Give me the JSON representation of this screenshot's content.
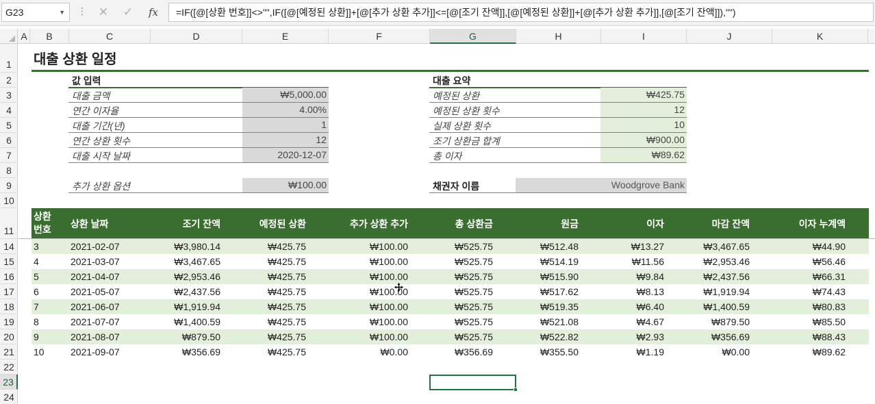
{
  "formula_bar": {
    "name_box": "G23",
    "cancel_glyph": "✕",
    "enter_glyph": "✓",
    "fx_label": "fx",
    "formula": "=IF([@[상환 번호]]<>\"\",IF([@[예정된 상환]]+[@[추가 상환 추가]]<=[@[조기 잔액]],[@[예정된 상환]]+[@[추가 상환 추가]],[@[조기 잔액]]),\"\")"
  },
  "columns": [
    "A",
    "B",
    "C",
    "D",
    "E",
    "F",
    "G",
    "H",
    "I",
    "J",
    "K"
  ],
  "selected_column": "G",
  "rows": [
    "1",
    "2",
    "3",
    "4",
    "5",
    "6",
    "7",
    "8",
    "9",
    "10",
    "11",
    "14",
    "15",
    "16",
    "17",
    "18",
    "19",
    "20",
    "21",
    "22",
    "23",
    "24"
  ],
  "selected_row": "23",
  "title": "대출 상환 일정",
  "inputs": {
    "heading": "값 입력",
    "items": [
      {
        "label": "대출 금액",
        "value": "₩5,000.00"
      },
      {
        "label": "연간 이자율",
        "value": "4.00%"
      },
      {
        "label": "대출 기간(년)",
        "value": "1"
      },
      {
        "label": "연간 상환 횟수",
        "value": "12"
      },
      {
        "label": "대출 시작 날짜",
        "value": "2020-12-07"
      }
    ],
    "extra": {
      "label": "추가 상환 옵션",
      "value": "₩100.00"
    }
  },
  "summary": {
    "heading": "대출 요약",
    "items": [
      {
        "label": "예정된 상환",
        "value": "₩425.75"
      },
      {
        "label": "예정된 상환 횟수",
        "value": "12"
      },
      {
        "label": "실제 상환 횟수",
        "value": "10"
      },
      {
        "label": "조기 상환금 합계",
        "value": "₩900.00"
      },
      {
        "label": "총 이자",
        "value": "₩89.62"
      }
    ],
    "lender": {
      "label": "채권자 이름",
      "value": "Woodgrove Bank"
    }
  },
  "table": {
    "headers": [
      "상환 번호",
      "상환 날짜",
      "조기 잔액",
      "예정된 상환",
      "추가 상환 추가",
      "총 상환금",
      "원금",
      "이자",
      "마감 잔액",
      "이자 누계액"
    ],
    "rows": [
      [
        "3",
        "2021-02-07",
        "₩3,980.14",
        "₩425.75",
        "₩100.00",
        "₩525.75",
        "₩512.48",
        "₩13.27",
        "₩3,467.65",
        "₩44.90"
      ],
      [
        "4",
        "2021-03-07",
        "₩3,467.65",
        "₩425.75",
        "₩100.00",
        "₩525.75",
        "₩514.19",
        "₩11.56",
        "₩2,953.46",
        "₩56.46"
      ],
      [
        "5",
        "2021-04-07",
        "₩2,953.46",
        "₩425.75",
        "₩100.00",
        "₩525.75",
        "₩515.90",
        "₩9.84",
        "₩2,437.56",
        "₩66.31"
      ],
      [
        "6",
        "2021-05-07",
        "₩2,437.56",
        "₩425.75",
        "₩100.00",
        "₩525.75",
        "₩517.62",
        "₩8.13",
        "₩1,919.94",
        "₩74.43"
      ],
      [
        "7",
        "2021-06-07",
        "₩1,919.94",
        "₩425.75",
        "₩100.00",
        "₩525.75",
        "₩519.35",
        "₩6.40",
        "₩1,400.59",
        "₩80.83"
      ],
      [
        "8",
        "2021-07-07",
        "₩1,400.59",
        "₩425.75",
        "₩100.00",
        "₩525.75",
        "₩521.08",
        "₩4.67",
        "₩879.50",
        "₩85.50"
      ],
      [
        "9",
        "2021-08-07",
        "₩879.50",
        "₩425.75",
        "₩100.00",
        "₩525.75",
        "₩522.82",
        "₩2.93",
        "₩356.69",
        "₩88.43"
      ],
      [
        "10",
        "2021-09-07",
        "₩356.69",
        "₩425.75",
        "₩0.00",
        "₩356.69",
        "₩355.50",
        "₩1.19",
        "₩0.00",
        "₩89.62"
      ]
    ]
  },
  "colors": {
    "accent": "#217346",
    "header_green": "#3a6e2f",
    "band_green": "#e2efda",
    "input_gray": "#d9d9d9"
  }
}
